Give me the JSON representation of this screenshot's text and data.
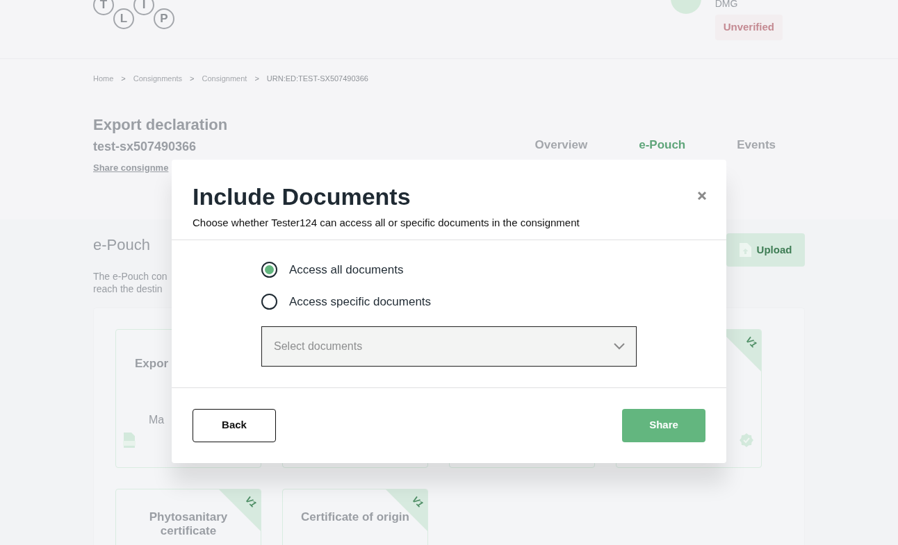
{
  "header": {
    "logo_letters": [
      "T",
      "L",
      "I",
      "P"
    ],
    "user": {
      "org": "DMG",
      "status": "Unverified"
    }
  },
  "breadcrumbs": [
    "Home",
    "Consignments",
    "Consignment",
    "URN:ED:TEST-SX507490366"
  ],
  "breadcrumb_separator": ">",
  "consignment": {
    "title": "Export declaration",
    "reference": "test-sx507490366",
    "share_link": "Share consignme"
  },
  "tabs": [
    {
      "label": "Overview",
      "selected": false
    },
    {
      "label": "e-Pouch",
      "selected": true
    },
    {
      "label": "Events",
      "selected": false
    }
  ],
  "epouch": {
    "heading": "e-Pouch",
    "description_lines": [
      "The e-Pouch con",
      "reach the destin"
    ],
    "upload_button": "Upload"
  },
  "documents": [
    {
      "kind": "xml",
      "title": "Expor",
      "subtitle": "Ma"
    },
    {
      "kind": "document"
    },
    {
      "kind": "document"
    },
    {
      "kind": "document",
      "version": "V1",
      "verified": true
    },
    {
      "kind": "document",
      "title": "Phytosanitary certificate",
      "version": "V1"
    },
    {
      "kind": "document",
      "title": "Certificate of origin",
      "version": "V1"
    }
  ],
  "dialog": {
    "title": "Include Documents",
    "subtitle": "Choose whether Tester124 can access all or specific documents in the consignment",
    "options": [
      {
        "label": "Access all documents",
        "selected": true
      },
      {
        "label": "Access specific documents",
        "selected": false
      }
    ],
    "select": {
      "placeholder": "Select documents"
    },
    "back_button": "Back",
    "share_button": "Share"
  }
}
